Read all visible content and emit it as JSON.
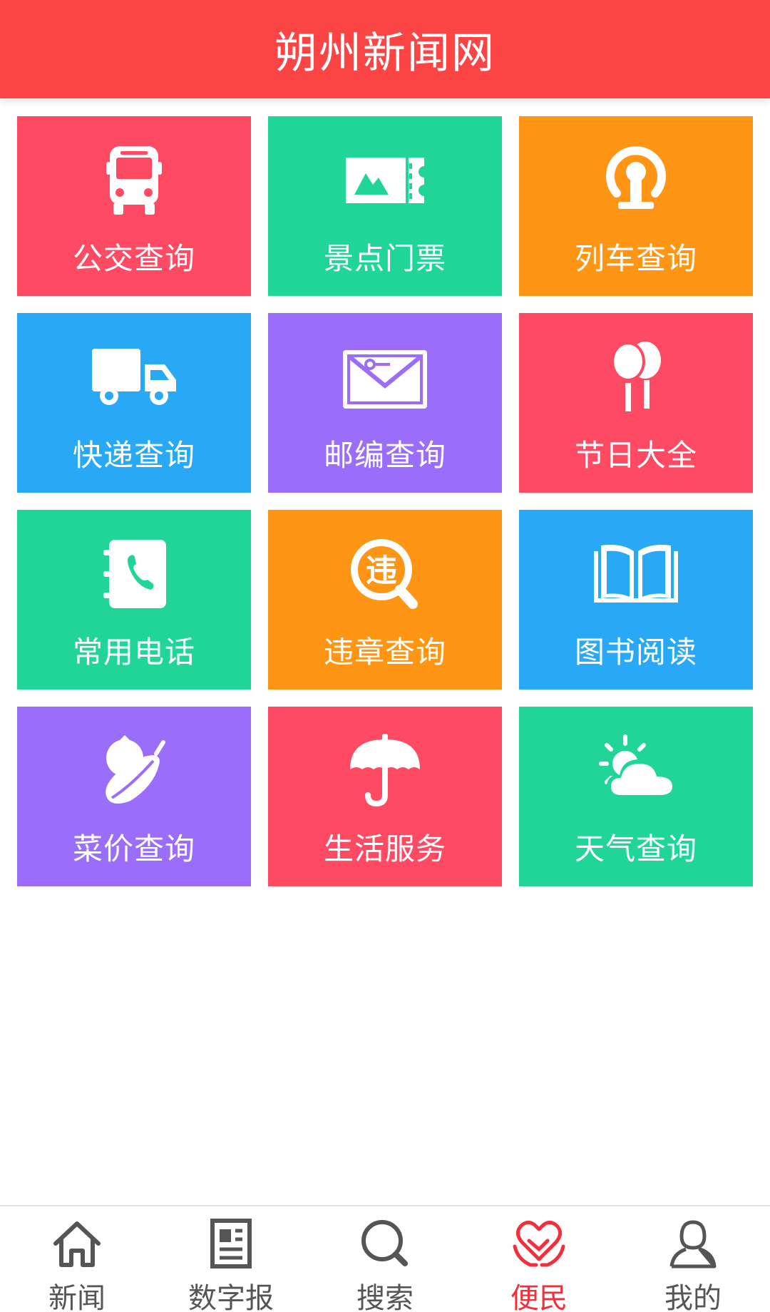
{
  "colors": {
    "header_bg": "#fb4545",
    "red": "#ff4a63",
    "green": "#21d598",
    "orange": "#ff9514",
    "blue": "#29a8f5",
    "purple": "#9a6dfb",
    "tab_inactive": "#555555",
    "tab_active": "#f2303c"
  },
  "header": {
    "title": "朔州新闻网"
  },
  "services": [
    {
      "label": "公交查询",
      "icon": "bus-icon",
      "color": "red"
    },
    {
      "label": "景点门票",
      "icon": "ticket-icon",
      "color": "green"
    },
    {
      "label": "列车查询",
      "icon": "train-icon",
      "color": "orange"
    },
    {
      "label": "快递查询",
      "icon": "truck-icon",
      "color": "blue"
    },
    {
      "label": "邮编查询",
      "icon": "envelope-icon",
      "color": "purple"
    },
    {
      "label": "节日大全",
      "icon": "balloons-icon",
      "color": "red"
    },
    {
      "label": "常用电话",
      "icon": "phonebook-icon",
      "color": "green"
    },
    {
      "label": "违章查询",
      "icon": "violation-search-icon",
      "color": "orange"
    },
    {
      "label": "图书阅读",
      "icon": "book-icon",
      "color": "blue"
    },
    {
      "label": "菜价查询",
      "icon": "vegetables-icon",
      "color": "purple"
    },
    {
      "label": "生活服务",
      "icon": "umbrella-icon",
      "color": "red"
    },
    {
      "label": "天气查询",
      "icon": "weather-icon",
      "color": "green"
    }
  ],
  "tabbar": {
    "items": [
      {
        "label": "新闻",
        "icon": "home-icon",
        "active": false
      },
      {
        "label": "数字报",
        "icon": "newspaper-icon",
        "active": false
      },
      {
        "label": "搜索",
        "icon": "search-icon",
        "active": false
      },
      {
        "label": "便民",
        "icon": "heart-hands-icon",
        "active": true
      },
      {
        "label": "我的",
        "icon": "user-icon",
        "active": false
      }
    ]
  },
  "violation_char": "违"
}
